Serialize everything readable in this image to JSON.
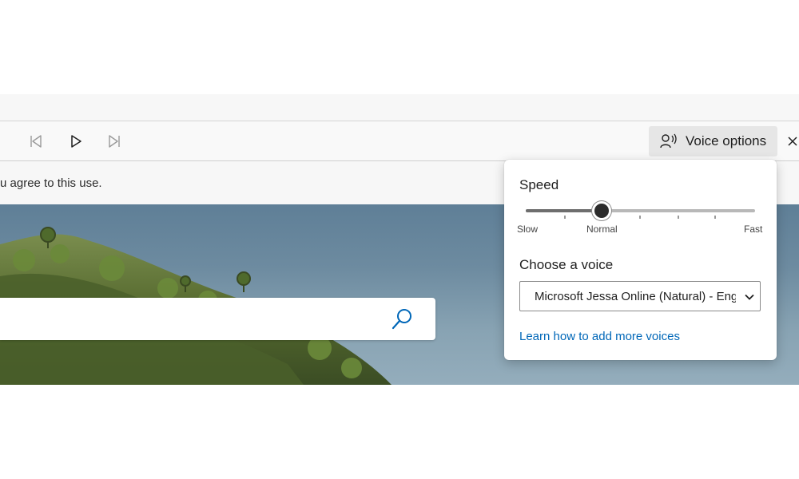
{
  "toolbar": {
    "prev_icon": "skip-previous-icon",
    "play_icon": "play-icon",
    "next_icon": "skip-next-icon",
    "voice_options_icon": "voice-person-icon",
    "voice_options_label": "Voice options",
    "close_icon": "close-icon"
  },
  "notice": {
    "text": "u agree to this use."
  },
  "search": {
    "value": "",
    "icon": "search-icon",
    "accent": "#0067b8"
  },
  "voice_flyout": {
    "speed_title": "Speed",
    "speed_value": 0.33,
    "speed_labels": {
      "slow": "Slow",
      "normal": "Normal",
      "fast": "Fast"
    },
    "choose_voice_title": "Choose a voice",
    "selected_voice": "Microsoft Jessa Online (Natural) - Engl",
    "dropdown_icon": "chevron-down-icon",
    "learn_more_link": "Learn how to add more voices",
    "link_color": "#0067b8"
  }
}
